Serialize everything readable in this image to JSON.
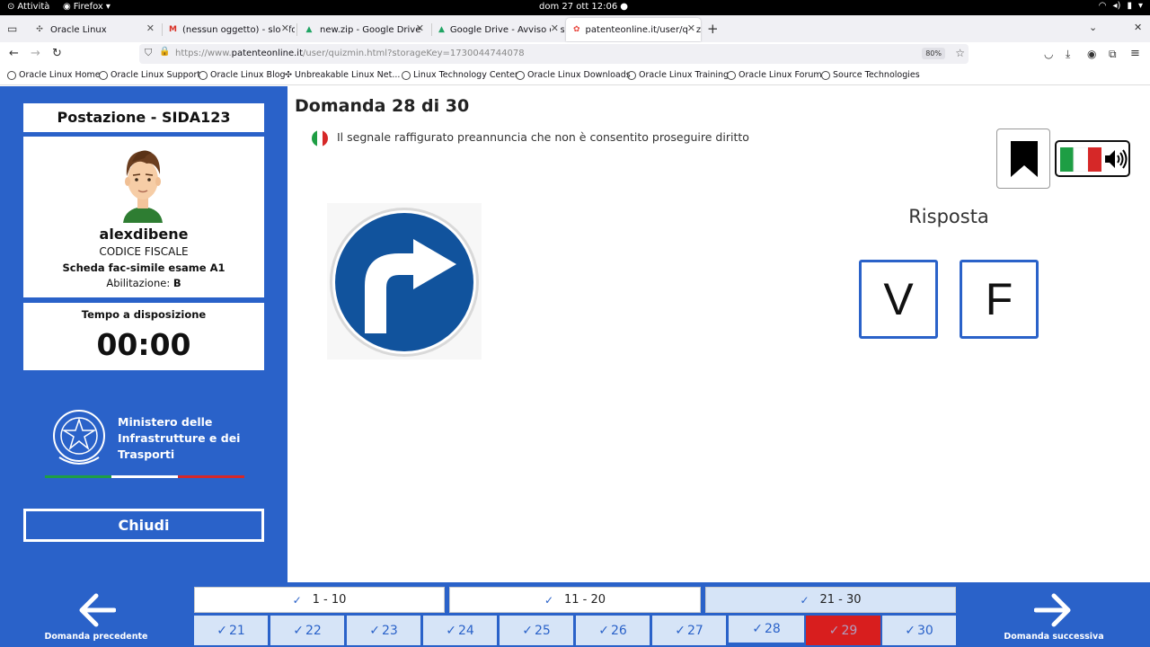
{
  "system": {
    "activities": "Attività",
    "app": "Firefox",
    "clock": "dom 27 ott  12:06"
  },
  "tabs": [
    {
      "title": "Oracle Linux"
    },
    {
      "title": "(nessun oggetto) - slowfo"
    },
    {
      "title": "new.zip - Google Drive"
    },
    {
      "title": "Google Drive - Avviso di s"
    },
    {
      "title": "patenteonline.it/user/quiz"
    }
  ],
  "url": {
    "prefix": "https://www.",
    "domain": "patenteonline.it",
    "path": "/user/quizmin.html?storageKey=1730044744078",
    "zoom": "80%"
  },
  "bookmarks": [
    "Oracle Linux Home",
    "Oracle Linux Support",
    "Oracle Linux Blog",
    "Unbreakable Linux Net...",
    "Linux Technology Center",
    "Oracle Linux Downloads",
    "Oracle Linux Training",
    "Oracle Linux Forum",
    "Source Technologies"
  ],
  "sidebar": {
    "workstation": "Postazione - SIDA123",
    "username": "alexdibene",
    "codice_fiscale": "CODICE FISCALE",
    "scheda": "Scheda fac-simile esame A1",
    "abilitazione_label": "Abilitazione:",
    "abilitazione_value": "B",
    "time_label": "Tempo a disposizione",
    "time_value": "00:00",
    "ministry": [
      "Ministero delle",
      "Infrastrutture e dei",
      "Trasporti"
    ],
    "close": "Chiudi"
  },
  "question": {
    "title": "Domanda 28 di 30",
    "text": "Il segnale raffigurato preannuncia che non è consentito proseguire diritto",
    "answer_label": "Risposta",
    "true_label": "V",
    "false_label": "F"
  },
  "nav": {
    "prev": "Domanda precedente",
    "next": "Domanda successiva",
    "ranges": [
      "1 - 10",
      "11 - 20",
      "21 - 30"
    ],
    "questions": [
      "21",
      "22",
      "23",
      "24",
      "25",
      "26",
      "27",
      "28",
      "29",
      "30"
    ]
  },
  "colors": {
    "primary": "#2a62c9",
    "current_red": "#d81e1e"
  }
}
